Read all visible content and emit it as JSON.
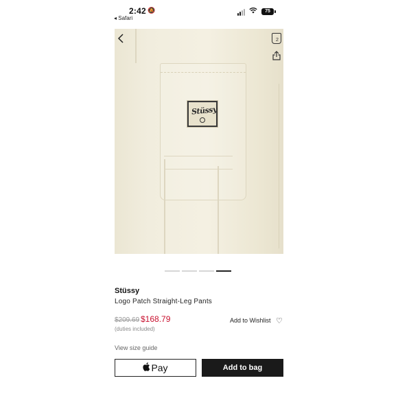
{
  "status_bar": {
    "time": "2:42",
    "back_app": "◂ Safari",
    "battery": "75",
    "bell_icon": "bell-slash-icon",
    "wifi_icon": "wifi-icon",
    "signal_icon": "cellular-signal-icon"
  },
  "nav": {
    "back_icon": "chevron-left-icon",
    "bag_icon": "shopping-bag-icon",
    "bag_count": "2",
    "share_icon": "share-icon"
  },
  "product_image": {
    "patch_text": "Stüssy"
  },
  "carousel": {
    "count": 4,
    "active_index": 3
  },
  "product": {
    "brand": "Stüssy",
    "name": "Logo Patch Straight-Leg Pants",
    "old_price": "$209.69",
    "new_price": "$168.79",
    "duties_note": "(duties included)",
    "wishlist_label": "Add to Wishlist",
    "size_guide_label": "View size guide"
  },
  "actions": {
    "apple_pay_label": "Pay",
    "add_to_bag_label": "Add to bag"
  },
  "colors": {
    "sale_price": "#c8102e",
    "primary_button": "#1a1a1a"
  }
}
